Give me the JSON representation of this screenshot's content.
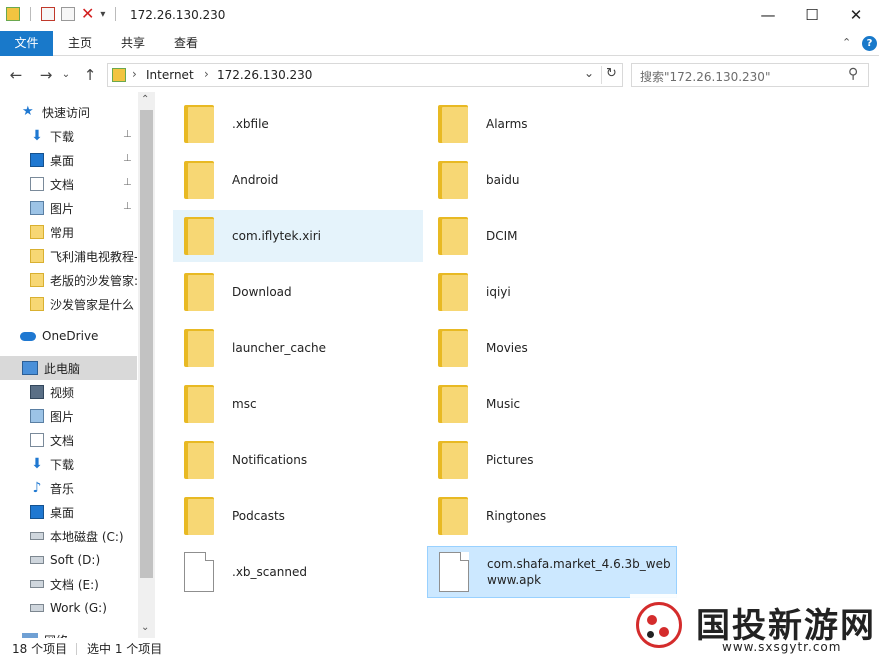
{
  "window": {
    "title": "172.26.130.230",
    "minimize": "—",
    "maximize": "☐",
    "close": "✕"
  },
  "ribbon": {
    "file": "文件",
    "tabs": [
      "主页",
      "共享",
      "查看"
    ]
  },
  "nav": {
    "back": "←",
    "forward": "→",
    "recent": "⌄",
    "up": "↑"
  },
  "address": {
    "segments": [
      "Internet",
      "172.26.130.230"
    ],
    "sep": "›",
    "dropdown": "⌄",
    "refresh": "↻"
  },
  "search": {
    "placeholder": "搜索\"172.26.130.230\"",
    "icon": "⚲"
  },
  "sidebar": {
    "quick_access": "快速访问",
    "quick_items": [
      {
        "label": "下载",
        "icon": "download-icon",
        "pinned": true
      },
      {
        "label": "桌面",
        "icon": "desktop-icon",
        "pinned": true
      },
      {
        "label": "文档",
        "icon": "documents-icon",
        "pinned": true
      },
      {
        "label": "图片",
        "icon": "pictures-icon",
        "pinned": true
      },
      {
        "label": "常用",
        "icon": "folder-icon",
        "pinned": false
      },
      {
        "label": "飞利浦电视教程-",
        "icon": "folder-icon",
        "pinned": false
      },
      {
        "label": "老版的沙发管家:",
        "icon": "folder-icon",
        "pinned": false
      },
      {
        "label": "沙发管家是什么",
        "icon": "folder-icon",
        "pinned": false
      }
    ],
    "onedrive": "OneDrive",
    "this_pc": "此电脑",
    "pc_items": [
      {
        "label": "视频",
        "icon": "videos-icon"
      },
      {
        "label": "图片",
        "icon": "pictures-icon"
      },
      {
        "label": "文档",
        "icon": "documents-icon"
      },
      {
        "label": "下载",
        "icon": "download-icon"
      },
      {
        "label": "音乐",
        "icon": "music-icon"
      },
      {
        "label": "桌面",
        "icon": "desktop-icon"
      },
      {
        "label": "本地磁盘 (C:)",
        "icon": "drive-icon"
      },
      {
        "label": "Soft (D:)",
        "icon": "drive-icon"
      },
      {
        "label": "文档 (E:)",
        "icon": "drive-icon"
      },
      {
        "label": "Work (G:)",
        "icon": "drive-icon"
      }
    ],
    "network": "网络"
  },
  "files": [
    {
      "name": ".xbfile",
      "type": "folder"
    },
    {
      "name": "Alarms",
      "type": "folder"
    },
    {
      "name": "Android",
      "type": "folder"
    },
    {
      "name": "baidu",
      "type": "folder"
    },
    {
      "name": "com.iflytek.xiri",
      "type": "folder",
      "state": "hover"
    },
    {
      "name": "DCIM",
      "type": "folder"
    },
    {
      "name": "Download",
      "type": "folder"
    },
    {
      "name": "iqiyi",
      "type": "folder"
    },
    {
      "name": "launcher_cache",
      "type": "folder"
    },
    {
      "name": "Movies",
      "type": "folder"
    },
    {
      "name": "msc",
      "type": "folder"
    },
    {
      "name": "Music",
      "type": "folder"
    },
    {
      "name": "Notifications",
      "type": "folder"
    },
    {
      "name": "Pictures",
      "type": "folder"
    },
    {
      "name": "Podcasts",
      "type": "folder"
    },
    {
      "name": "Ringtones",
      "type": "folder"
    },
    {
      "name": ".xb_scanned",
      "type": "file"
    },
    {
      "name": "com.shafa.market_4.6.3b_webwww.apk",
      "type": "file",
      "state": "selected"
    }
  ],
  "status": {
    "count": "18 个项目",
    "selected": "选中 1 个项目"
  },
  "watermark": {
    "title": "国投新游网",
    "url": "www.sxsgytr.com"
  },
  "colors": {
    "accent": "#1979ca",
    "folder": "#f7d774",
    "selection": "#cce8ff",
    "hover": "#e5f3fb"
  }
}
